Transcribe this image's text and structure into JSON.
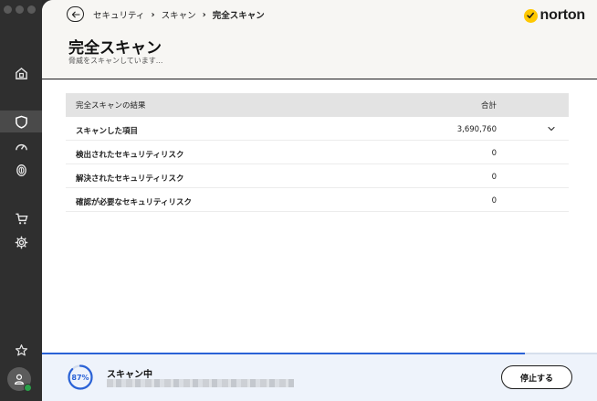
{
  "sidebar": {
    "items": [
      {
        "icon": "home-security-icon"
      },
      {
        "icon": "shield-icon",
        "active": true
      },
      {
        "icon": "speedometer-icon"
      },
      {
        "icon": "fingerprint-icon"
      },
      {
        "icon": "cart-icon"
      },
      {
        "icon": "gear-icon"
      },
      {
        "icon": "star-icon"
      },
      {
        "icon": "account-icon"
      }
    ]
  },
  "header": {
    "breadcrumb": [
      "セキュリティ",
      "スキャン",
      "完全スキャン"
    ],
    "logo_text": "norton",
    "title": "完全スキャン",
    "subtitle": "脅威をスキャンしています..."
  },
  "results": {
    "columns": [
      "完全スキャンの結果",
      "合計"
    ],
    "rows": [
      {
        "label": "スキャンした項目",
        "value": "3,690,760",
        "expandable": true
      },
      {
        "label": "検出されたセキュリティリスク",
        "value": "0"
      },
      {
        "label": "解決されたセキュリティリスク",
        "value": "0"
      },
      {
        "label": "確認が必要なセキュリティリスク",
        "value": "0"
      }
    ]
  },
  "footer": {
    "progress_fraction": 0.87,
    "progress_label": "87%",
    "status": "スキャン中",
    "stop_label": "停止する"
  },
  "colors": {
    "accent": "#2a62d6",
    "brand": "#ffc800",
    "sidebar_bg": "#2f2f2f",
    "status_online": "#2aa24a"
  }
}
